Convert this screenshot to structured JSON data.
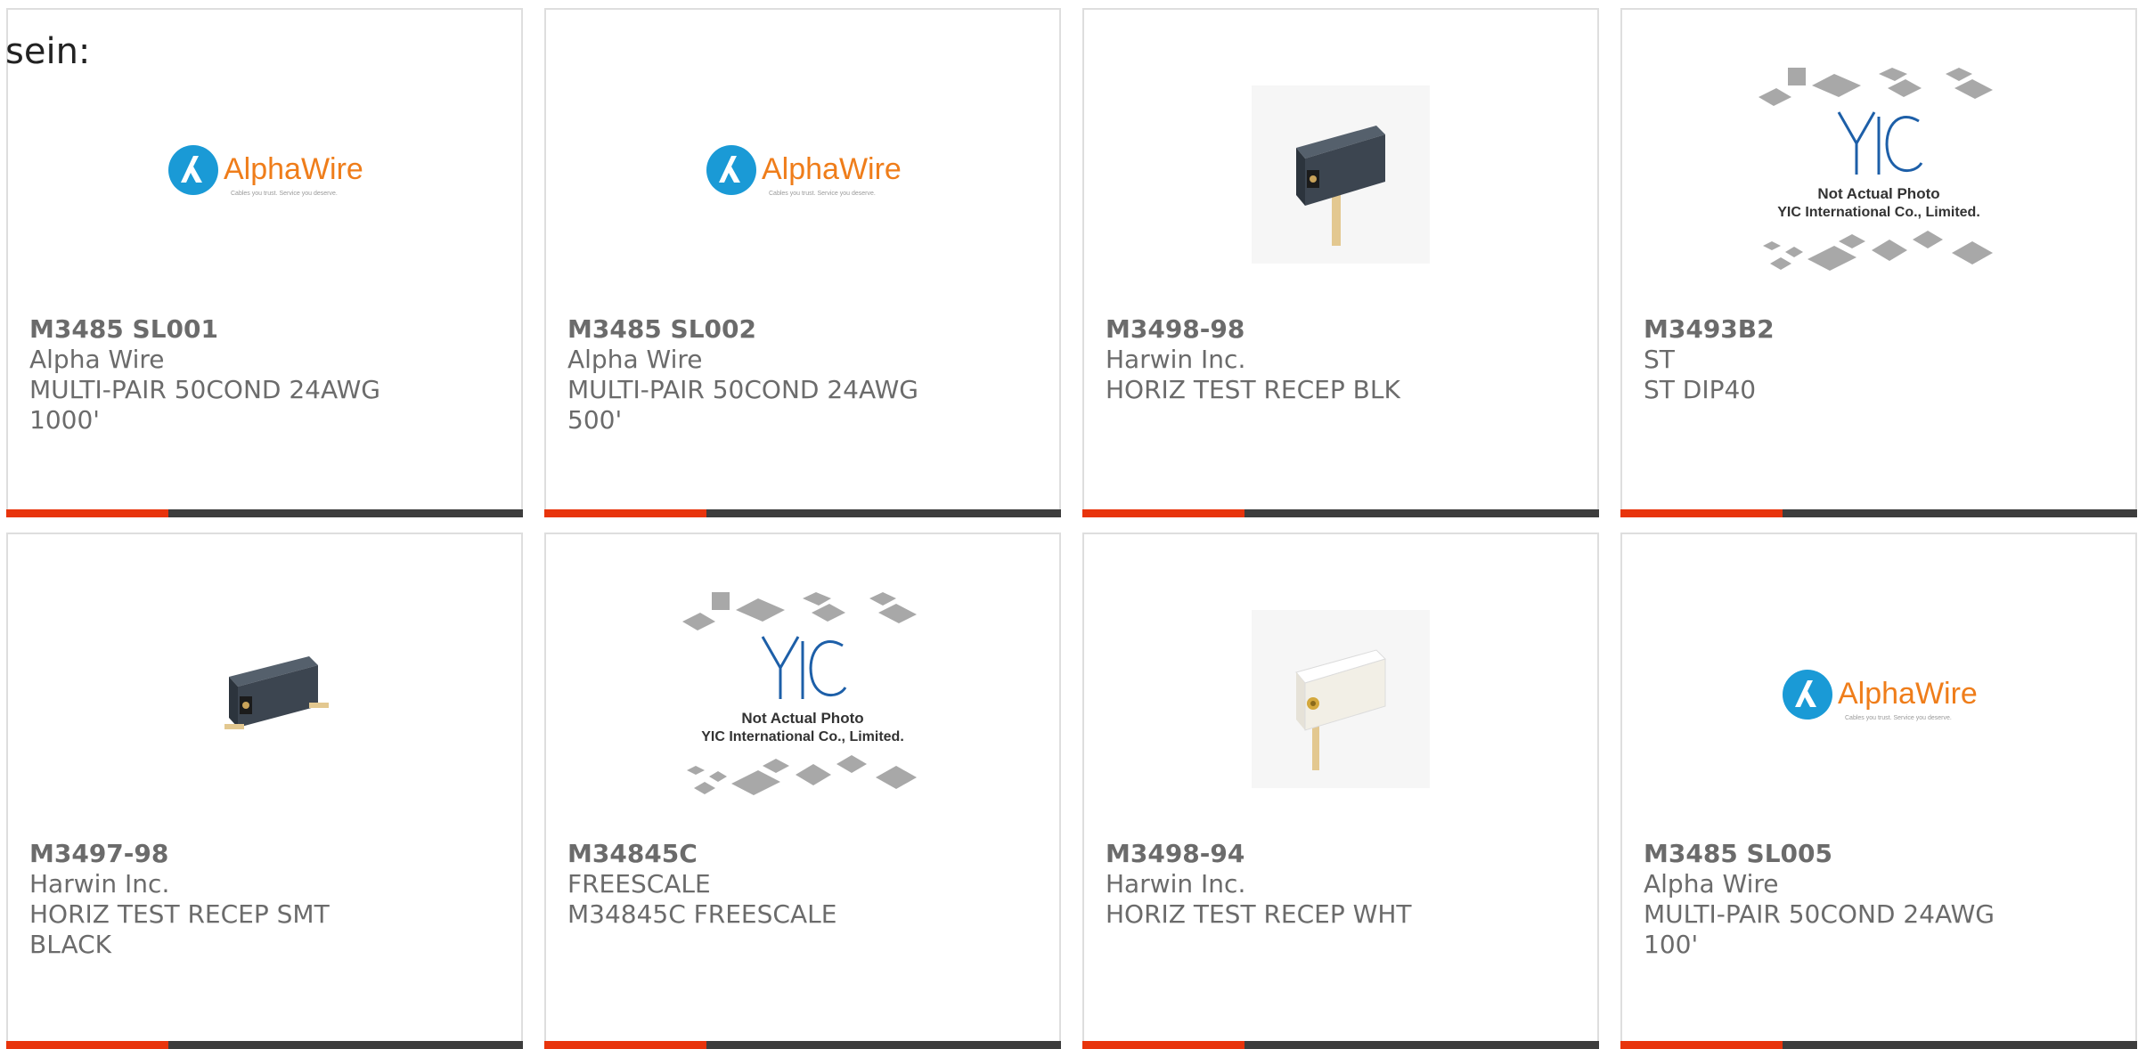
{
  "page": {
    "heading": "sein:"
  },
  "colors": {
    "accent": "#e8340c",
    "bar": "#3d3d3d",
    "card_border": "#dedede",
    "text": "#6b6b6b"
  },
  "logos": {
    "alphawire": {
      "name": "AlphaWire",
      "tagline": "Cables you trust. Service you deserve."
    },
    "yic": {
      "mark": "YIC",
      "line1": "Not Actual Photo",
      "line2": "YIC International Co., Limited."
    }
  },
  "products": [
    {
      "part_number": "M3485 SL001",
      "manufacturer": "Alpha Wire",
      "description": "MULTI-PAIR 50COND 24AWG 1000'",
      "image": "alphawire-logo"
    },
    {
      "part_number": "M3485 SL002",
      "manufacturer": "Alpha Wire",
      "description": "MULTI-PAIR 50COND 24AWG 500'",
      "image": "alphawire-logo"
    },
    {
      "part_number": "M3498-98",
      "manufacturer": "Harwin Inc.",
      "description": "HORIZ TEST RECEP BLK",
      "image": "connector-black"
    },
    {
      "part_number": "M3493B2",
      "manufacturer": "ST",
      "description": "ST DIP40",
      "image": "yic-placeholder"
    },
    {
      "part_number": "M3497-98",
      "manufacturer": "Harwin Inc.",
      "description": "HORIZ TEST RECEP SMT BLACK",
      "image": "connector-black-smt"
    },
    {
      "part_number": "M34845C",
      "manufacturer": "FREESCALE",
      "description": "M34845C FREESCALE",
      "image": "yic-placeholder"
    },
    {
      "part_number": "M3498-94",
      "manufacturer": "Harwin Inc.",
      "description": "HORIZ TEST RECEP WHT",
      "image": "connector-white"
    },
    {
      "part_number": "M3485 SL005",
      "manufacturer": "Alpha Wire",
      "description": "MULTI-PAIR 50COND 24AWG 100'",
      "image": "alphawire-logo"
    }
  ]
}
